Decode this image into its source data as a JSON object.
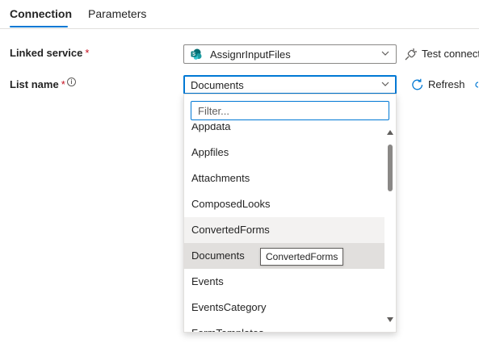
{
  "tabs": [
    {
      "label": "Connection",
      "active": true
    },
    {
      "label": "Parameters",
      "active": false
    }
  ],
  "linked_service": {
    "label": "Linked service",
    "required_mark": "*",
    "value": "AssignrInputFiles",
    "icon": "sharepoint-icon"
  },
  "test_connection": {
    "label": "Test connect",
    "icon": "plug-icon"
  },
  "list_name": {
    "label": "List name",
    "required_mark": "*",
    "info_icon": "i",
    "value": "Documents"
  },
  "refresh": {
    "label": "Refresh",
    "icon": "refresh-icon"
  },
  "filter": {
    "placeholder": "Filter..."
  },
  "dropdown_items": [
    "Appdata",
    "Appfiles",
    "Attachments",
    "ComposedLooks",
    "ConvertedForms",
    "Documents",
    "Events",
    "EventsCategory",
    "FormTemplates"
  ],
  "hovered_item": "ConvertedForms",
  "selected_item": "Documents",
  "tooltip": "ConvertedForms",
  "colors": {
    "accent": "#0078d4",
    "required": "#c50f1f",
    "sharepoint": "#038387"
  }
}
